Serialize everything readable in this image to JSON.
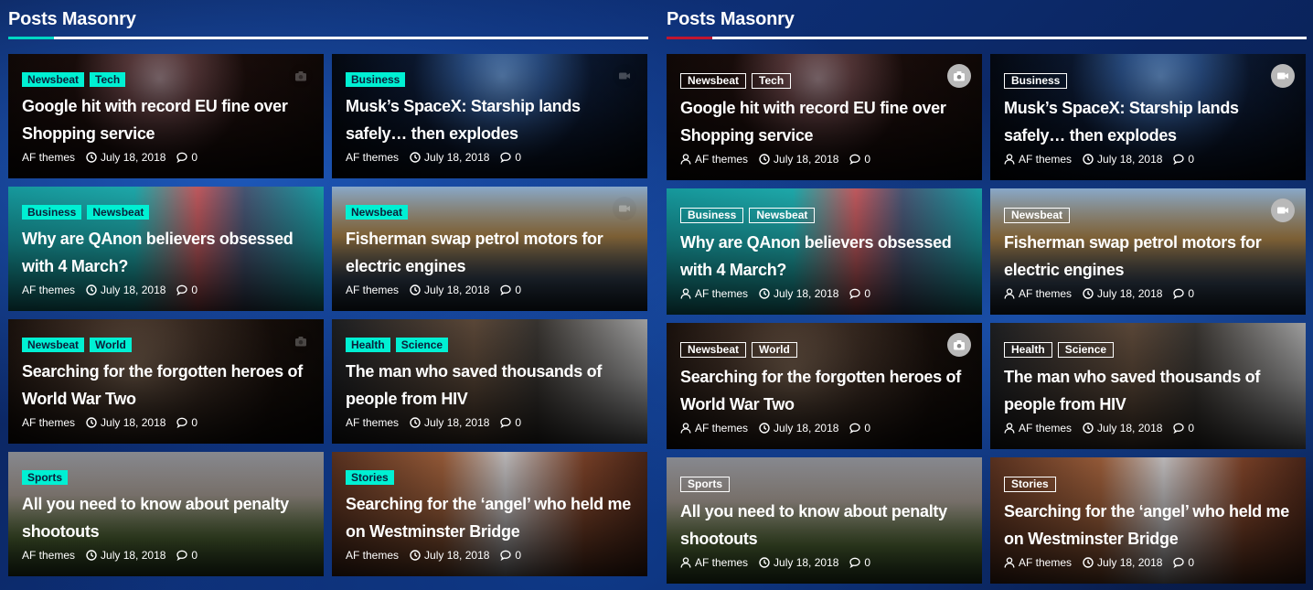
{
  "sections": [
    {
      "title": "Posts Masonry",
      "accent_color": "#00d7c3",
      "tag_style": "filled"
    },
    {
      "title": "Posts Masonry",
      "accent_color": "#c0152f",
      "tag_style": "outline"
    }
  ],
  "tag_fill_color": "#00f0d3",
  "posts": [
    {
      "cats": [
        "Newsbeat",
        "Tech"
      ],
      "title": "Google hit with record EU fine over Shopping service",
      "author": "AF themes",
      "date": "July 18, 2018",
      "comments": "0",
      "media": "camera-icon"
    },
    {
      "cats": [
        "Business"
      ],
      "title": "Musk’s SpaceX: Starship lands safely… then explodes",
      "author": "AF themes",
      "date": "July 18, 2018",
      "comments": "0",
      "media": "video-icon"
    },
    {
      "cats": [
        "Business",
        "Newsbeat"
      ],
      "title": "Why are QAnon believers obsessed with 4 March?",
      "author": "AF themes",
      "date": "July 18, 2018",
      "comments": "0",
      "media": ""
    },
    {
      "cats": [
        "Newsbeat"
      ],
      "title": "Fisherman swap petrol motors for electric engines",
      "author": "AF themes",
      "date": "July 18, 2018",
      "comments": "0",
      "media": "video-icon"
    },
    {
      "cats": [
        "Newsbeat",
        "World"
      ],
      "title": "Searching for the forgotten heroes of World War Two",
      "author": "AF themes",
      "date": "July 18, 2018",
      "comments": "0",
      "media": "camera-icon"
    },
    {
      "cats": [
        "Health",
        "Science"
      ],
      "title": "The man who saved thousands of people from HIV",
      "author": "AF themes",
      "date": "July 18, 2018",
      "comments": "0",
      "media": ""
    },
    {
      "cats": [
        "Sports"
      ],
      "title": "All you need to know about penalty shootouts",
      "author": "AF themes",
      "date": "July 18, 2018",
      "comments": "0",
      "media": ""
    },
    {
      "cats": [
        "Stories"
      ],
      "title": "Searching for the ‘angel’ who held me on Westminster Bridge",
      "author": "AF themes",
      "date": "July 18, 2018",
      "comments": "0",
      "media": ""
    }
  ]
}
